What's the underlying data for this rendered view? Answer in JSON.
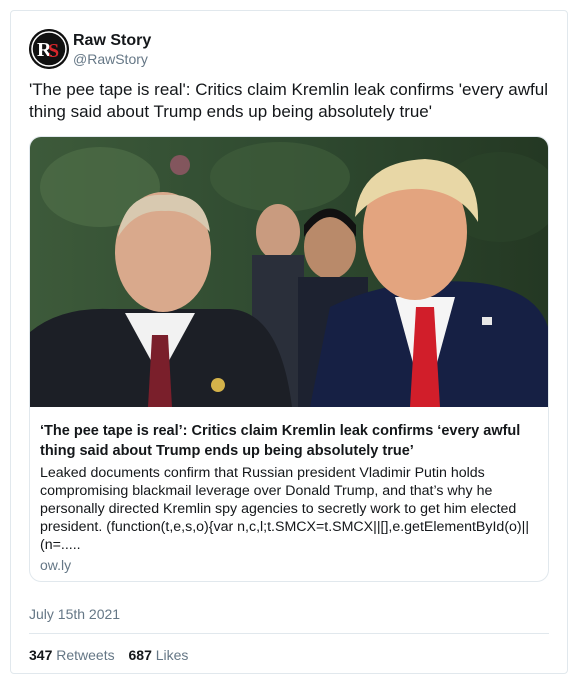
{
  "account": {
    "logo_text": "RS",
    "name": "Raw Story",
    "handle": "@RawStory"
  },
  "tweet": {
    "text": "'The pee tape is real': Critics claim Kremlin leak confirms 'every awful thing said about Trump ends up being absolutely true'"
  },
  "card": {
    "title": "‘The pee tape is real’: Critics claim Kremlin leak confirms ‘every awful thing said about Trump ends up being absolutely true’",
    "description": "Leaked documents confirm that Russian president Vladimir Putin holds compromising blackmail leverage over Donald Trump, and that’s why he personally directed Kremlin spy agencies to secretly work to get him elected president. (function(t,e,s,o){var n,c,l;t.SMCX=t.SMCX||[],e.getElementById(o)||(n=.....",
    "domain": "ow.ly"
  },
  "date": "July 15th 2021",
  "stats": {
    "retweets_count": "347",
    "retweets_label": "Retweets",
    "likes_count": "687",
    "likes_label": "Likes"
  },
  "colors": {
    "text": "#14171a",
    "secondary": "#657786",
    "border": "#e1e8ed",
    "logo_red": "#d6262b"
  }
}
